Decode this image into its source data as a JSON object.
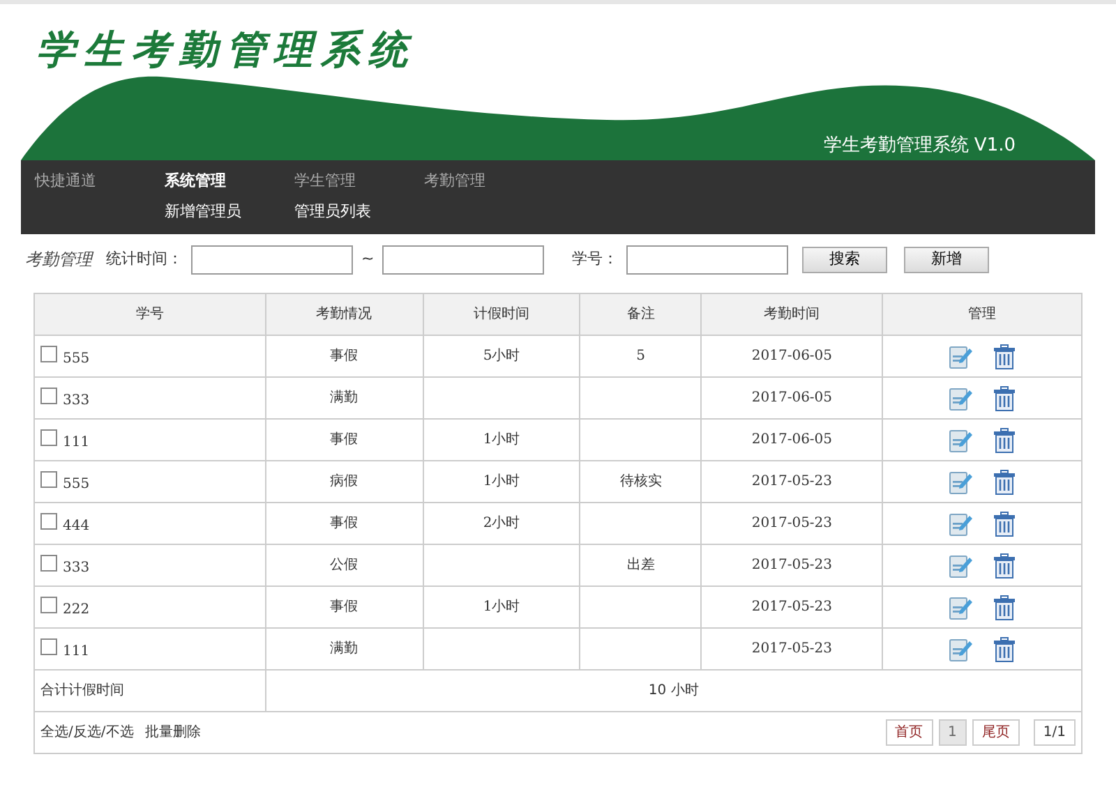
{
  "header": {
    "title": "学生考勤管理系统",
    "subtitle": "学生考勤管理系统 V1.0"
  },
  "nav": {
    "quick_label": "快捷通道",
    "items": [
      {
        "label": "系统管理",
        "selected": true
      },
      {
        "label": "学生管理",
        "selected": false
      },
      {
        "label": "考勤管理",
        "selected": false
      }
    ],
    "sub_items": [
      "新增管理员",
      "管理员列表"
    ]
  },
  "search": {
    "section": "考勤管理",
    "time_label": "统计时间：",
    "range_sep": "~",
    "id_label": "学号：",
    "buttons": [
      "搜索",
      "新增"
    ]
  },
  "table": {
    "columns": [
      "学号",
      "考勤情况",
      "计假时间",
      "备注",
      "考勤时间",
      "管理"
    ],
    "rows": [
      {
        "id": "555",
        "status": "事假",
        "hours": "5小时",
        "note": "5",
        "date": "2017-06-05",
        "checked": false
      },
      {
        "id": "333",
        "status": "满勤",
        "hours": "",
        "note": "",
        "date": "2017-06-05",
        "checked": false
      },
      {
        "id": "111",
        "status": "事假",
        "hours": "1小时",
        "note": "",
        "date": "2017-06-05",
        "checked": false
      },
      {
        "id": "555",
        "status": "病假",
        "hours": "1小时",
        "note": "待核实",
        "date": "2017-05-23",
        "checked": false
      },
      {
        "id": "444",
        "status": "事假",
        "hours": "2小时",
        "note": "",
        "date": "2017-05-23",
        "checked": false
      },
      {
        "id": "333",
        "status": "公假",
        "hours": "",
        "note": "出差",
        "date": "2017-05-23",
        "checked": false
      },
      {
        "id": "222",
        "status": "事假",
        "hours": "1小时",
        "note": "",
        "date": "2017-05-23",
        "checked": false
      },
      {
        "id": "111",
        "status": "满勤",
        "hours": "",
        "note": "",
        "date": "2017-05-23",
        "checked": false
      }
    ],
    "total": {
      "label": "合计计假时间",
      "value": "10 小时"
    },
    "select_links": [
      "全选",
      "反选",
      "不选"
    ],
    "link_separator": "/",
    "batch_action": "批量删除",
    "pagination": [
      {
        "label": "首页",
        "kind": "link",
        "selected": false
      },
      {
        "label": "1",
        "kind": "page",
        "selected": true
      },
      {
        "label": "尾页",
        "kind": "link",
        "selected": false
      },
      {
        "label": "1/1",
        "kind": "info",
        "selected": false
      }
    ]
  }
}
